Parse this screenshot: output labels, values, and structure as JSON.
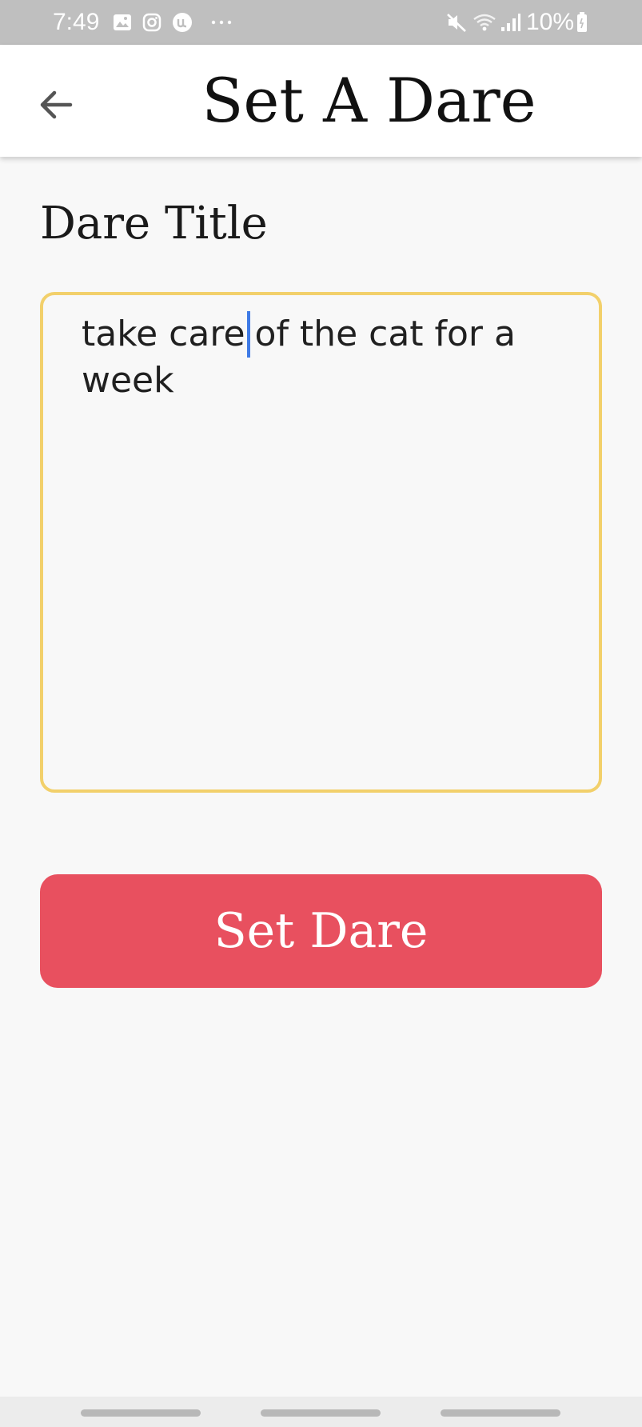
{
  "status_bar": {
    "time": "7:49",
    "left_icons": [
      "gallery-icon",
      "instagram-icon",
      "app-notification-icon",
      "more-dots-icon"
    ],
    "right_icons": [
      "mute-icon",
      "wifi-icon",
      "signal-icon",
      "battery-icon"
    ],
    "battery_percent": "10%"
  },
  "app_bar": {
    "back_icon": "arrow-left-icon",
    "title": "Set A Dare"
  },
  "form": {
    "label": "Dare Title",
    "input_value_before_caret": "take care",
    "input_value_after_caret": "of the cat for a week",
    "border_color": "#f2d06b"
  },
  "button": {
    "label": "Set Dare",
    "color": "#e8505f"
  }
}
